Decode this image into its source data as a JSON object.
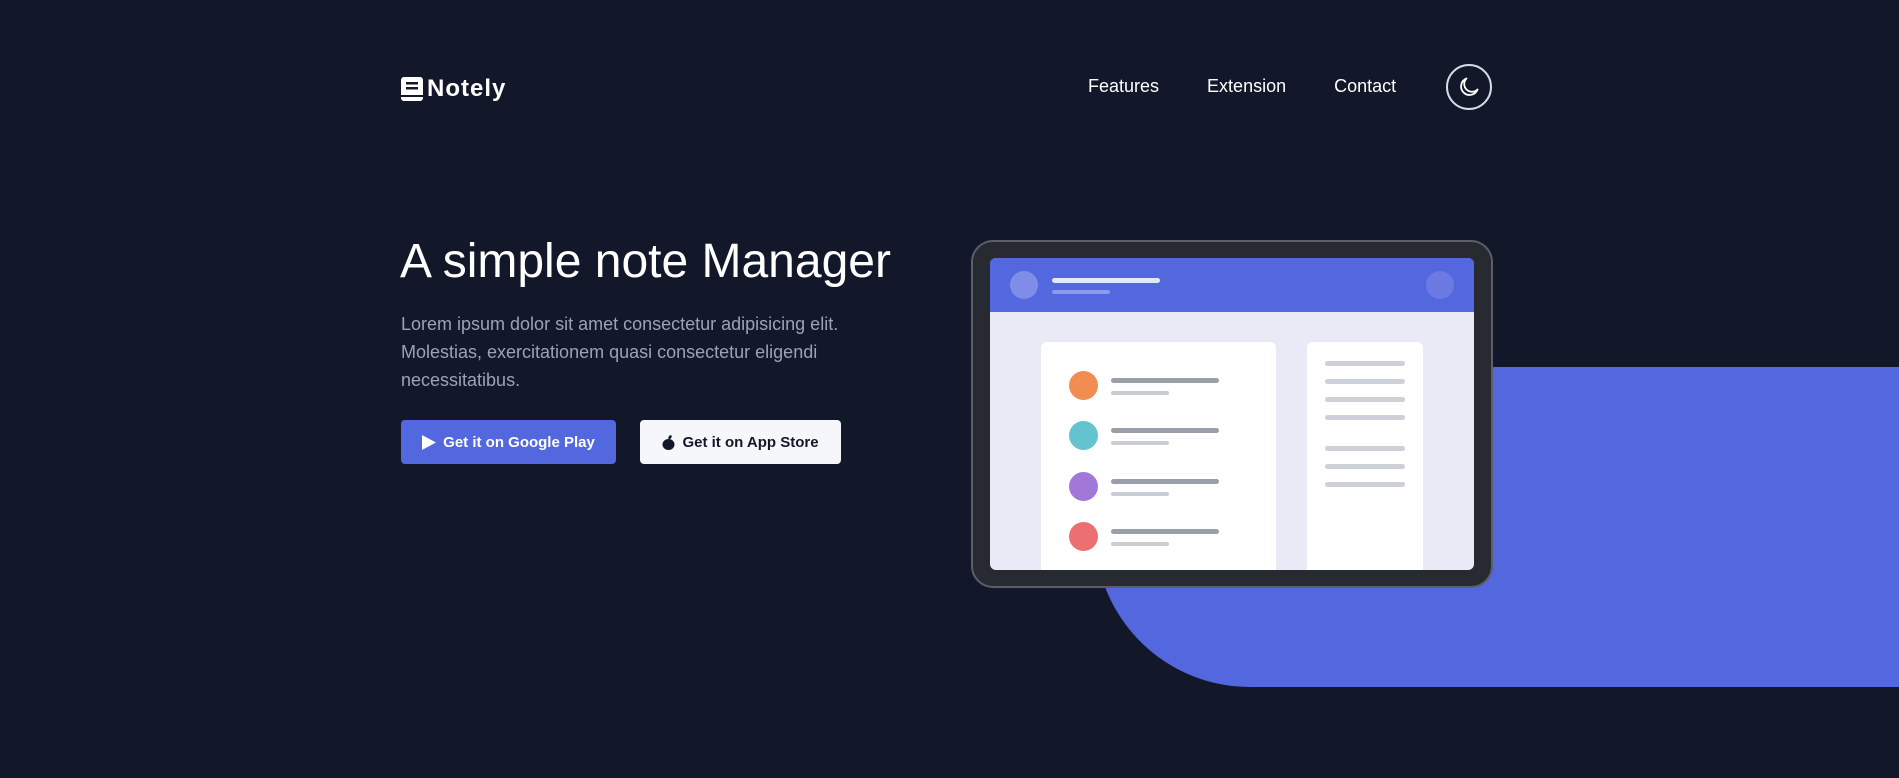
{
  "nav": {
    "brand": "Notely",
    "links": [
      "Features",
      "Extension",
      "Contact"
    ],
    "theme_toggle_icon": "moon-icon"
  },
  "hero": {
    "title": "A simple note Manager",
    "description": "Lorem ipsum dolor sit amet consectetur adipisicing elit. Molestias, exercitationem quasi consectetur eligendi necessitatibus.",
    "buttons": {
      "google": {
        "label": "Get it on Google Play",
        "icon": "play-icon"
      },
      "apple": {
        "label": "Get it on App Store",
        "icon": "apple-icon"
      }
    }
  },
  "mockup": {
    "list_dot_colors": [
      "#f28d52",
      "#63c4cf",
      "#a178d8",
      "#ec6f71"
    ]
  },
  "colors": {
    "background": "#121829",
    "accent": "#5367df",
    "text_muted": "#9aa3b6"
  }
}
